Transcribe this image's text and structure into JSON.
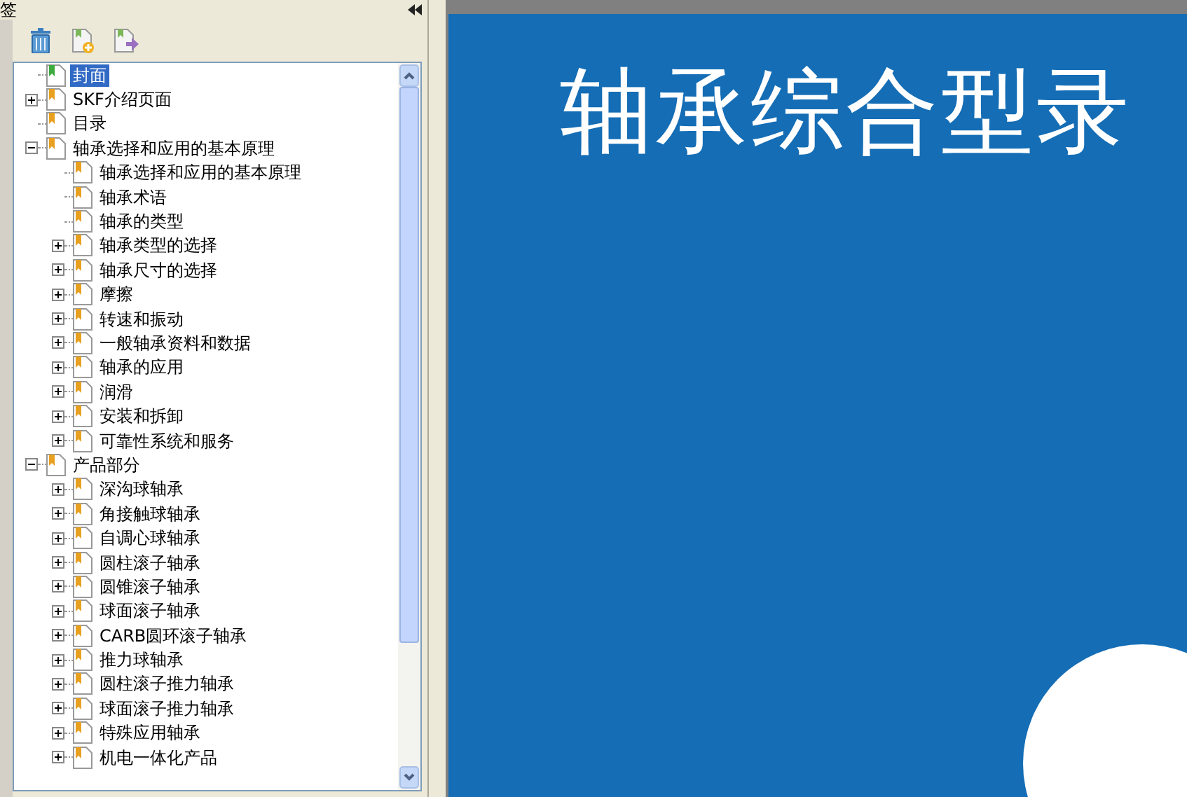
{
  "panel": {
    "title": "签"
  },
  "tree": [
    {
      "label": "封面",
      "kind": "leaf",
      "selected": true
    },
    {
      "label": "SKF介绍页面",
      "kind": "group",
      "expanded": false,
      "selected": false
    },
    {
      "label": "目录",
      "kind": "leaf",
      "selected": false
    },
    {
      "label": "轴承选择和应用的基本原理",
      "kind": "group",
      "expanded": true,
      "selected": false,
      "children": [
        {
          "label": "轴承选择和应用的基本原理",
          "kind": "leaf",
          "selected": false
        },
        {
          "label": "轴承术语",
          "kind": "leaf",
          "selected": false
        },
        {
          "label": "轴承的类型",
          "kind": "leaf",
          "selected": false
        },
        {
          "label": "轴承类型的选择",
          "kind": "group",
          "expanded": false,
          "selected": false
        },
        {
          "label": "轴承尺寸的选择",
          "kind": "group",
          "expanded": false,
          "selected": false
        },
        {
          "label": "摩擦",
          "kind": "group",
          "expanded": false,
          "selected": false
        },
        {
          "label": "转速和振动",
          "kind": "group",
          "expanded": false,
          "selected": false
        },
        {
          "label": "一般轴承资料和数据",
          "kind": "group",
          "expanded": false,
          "selected": false
        },
        {
          "label": "轴承的应用",
          "kind": "group",
          "expanded": false,
          "selected": false
        },
        {
          "label": "润滑",
          "kind": "group",
          "expanded": false,
          "selected": false
        },
        {
          "label": "安装和拆卸",
          "kind": "group",
          "expanded": false,
          "selected": false
        },
        {
          "label": "可靠性系统和服务",
          "kind": "group",
          "expanded": false,
          "selected": false
        }
      ]
    },
    {
      "label": "产品部分",
      "kind": "group",
      "expanded": true,
      "selected": false,
      "children": [
        {
          "label": "深沟球轴承",
          "kind": "group",
          "expanded": false,
          "selected": false
        },
        {
          "label": "角接触球轴承",
          "kind": "group",
          "expanded": false,
          "selected": false
        },
        {
          "label": "自调心球轴承",
          "kind": "group",
          "expanded": false,
          "selected": false
        },
        {
          "label": "圆柱滚子轴承",
          "kind": "group",
          "expanded": false,
          "selected": false
        },
        {
          "label": "圆锥滚子轴承",
          "kind": "group",
          "expanded": false,
          "selected": false
        },
        {
          "label": "球面滚子轴承",
          "kind": "group",
          "expanded": false,
          "selected": false
        },
        {
          "label": "CARB圆环滚子轴承",
          "kind": "group",
          "expanded": false,
          "selected": false
        },
        {
          "label": "推力球轴承",
          "kind": "group",
          "expanded": false,
          "selected": false
        },
        {
          "label": "圆柱滚子推力轴承",
          "kind": "group",
          "expanded": false,
          "selected": false
        },
        {
          "label": "球面滚子推力轴承",
          "kind": "group",
          "expanded": false,
          "selected": false
        },
        {
          "label": "特殊应用轴承",
          "kind": "group",
          "expanded": false,
          "selected": false
        },
        {
          "label": "机电一体化产品",
          "kind": "group",
          "expanded": false,
          "selected": false
        }
      ]
    }
  ],
  "page": {
    "title": "轴承综合型录"
  }
}
